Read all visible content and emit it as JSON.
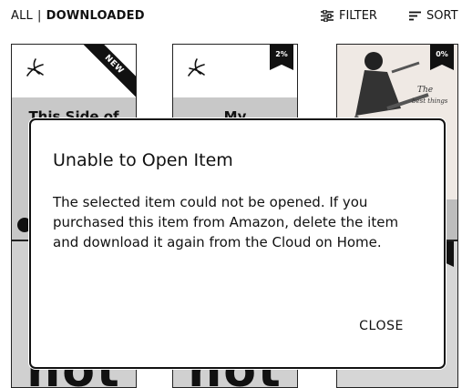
{
  "filters": {
    "all_label": "ALL",
    "separator": "|",
    "downloaded_label": "DOWNLOADED"
  },
  "toolbar": {
    "filter_label": "FILTER",
    "filter_icon": "sliders-icon",
    "sort_label": "SORT",
    "sort_icon": "sort-lines-icon"
  },
  "library": {
    "books": [
      {
        "title": "This Side of",
        "badge": "NEW",
        "icon": "pdf-icon"
      },
      {
        "title": "My",
        "badge": "2%",
        "icon": "pdf-icon"
      },
      {
        "title": "The best things",
        "badge": "0%",
        "icon": "fashion-illustration"
      }
    ],
    "row2_big_text": [
      "not",
      "not"
    ]
  },
  "dialog": {
    "title": "Unable to Open Item",
    "message": "The selected item could not be opened. If you purchased this item from Amazon, delete the item and download it again from the Cloud on Home.",
    "close_label": "CLOSE"
  }
}
